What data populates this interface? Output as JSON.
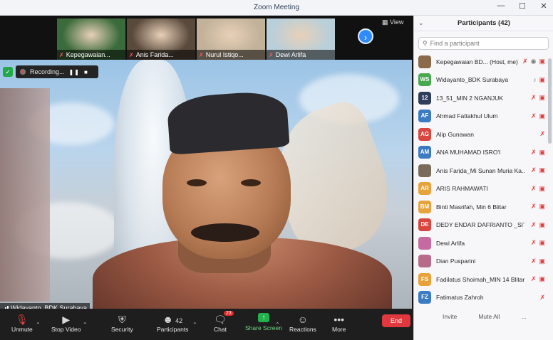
{
  "window": {
    "title": "Zoom Meeting"
  },
  "thumbnails": [
    {
      "name": "Kepegawaian...",
      "bg": "#3a6b3a",
      "muted": true
    },
    {
      "name": "Anis Farida...",
      "bg": "#5a4a3c",
      "muted": true
    },
    {
      "name": "Nurul Istiqo...",
      "bg": "#c3b29a",
      "muted": true
    },
    {
      "name": "Dewi Arlifa",
      "bg": "#b9cfd9",
      "muted": true
    }
  ],
  "view_label": "View",
  "recording": {
    "label": "Recording..."
  },
  "active_speaker": "Widayanto_BDK Surabaya",
  "toolbar": {
    "unmute": "Unmute",
    "stop_video": "Stop Video",
    "security": "Security",
    "participants": "Participants",
    "participants_count": "42",
    "chat": "Chat",
    "chat_badge": "23",
    "share_screen": "Share Screen",
    "reactions": "Reactions",
    "more": "More",
    "end": "End"
  },
  "panel": {
    "title": "Participants (42)",
    "search_placeholder": "Find a participant",
    "invite": "Invite",
    "mute_all": "Mute All",
    "more": "..."
  },
  "participants": [
    {
      "initials": "",
      "name": "Kepegawaian BD... (Host, me)",
      "color": "#8a6a4a",
      "icons": [
        "mic-muted",
        "record",
        "video-off"
      ]
    },
    {
      "initials": "WS",
      "name": "Widayanto_BDK Surabaya",
      "color": "#4aa84f",
      "icons": [
        "mic-on",
        "video-off"
      ]
    },
    {
      "initials": "12",
      "name": "13_51_MIN 2 NGANJUK",
      "color": "#2e3d5a",
      "icons": [
        "mic-muted",
        "video-off"
      ]
    },
    {
      "initials": "AF",
      "name": "Ahmad Fattakhul Ulum",
      "color": "#3b7bc4",
      "icons": [
        "mic-muted",
        "video-off"
      ]
    },
    {
      "initials": "AG",
      "name": "Alip Gunawan",
      "color": "#d9463f",
      "icons": [
        "mic-muted"
      ]
    },
    {
      "initials": "AM",
      "name": "ANA MUHAMAD ISRO'I",
      "color": "#3b7bc4",
      "icons": [
        "mic-muted",
        "video-off"
      ]
    },
    {
      "initials": "",
      "name": "Anis Farida_Mi Sunan Muria Ka...",
      "color": "#7a6a5a",
      "icons": [
        "mic-muted",
        "video-off"
      ]
    },
    {
      "initials": "AR",
      "name": "ARIS RAHMAWATI",
      "color": "#e8a23a",
      "icons": [
        "mic-muted",
        "video-off"
      ]
    },
    {
      "initials": "BM",
      "name": "Binti Masrifah, Min 6 Blitar",
      "color": "#e8a23a",
      "icons": [
        "mic-muted",
        "video-off"
      ]
    },
    {
      "initials": "DE",
      "name": "DEDY ENDAR DAFRIANTO _SITU...",
      "color": "#d9463f",
      "icons": [
        "mic-muted",
        "video-off"
      ]
    },
    {
      "initials": "",
      "name": "Dewi Arlifa",
      "color": "#c66aa0",
      "icons": [
        "mic-muted",
        "video-off"
      ]
    },
    {
      "initials": "",
      "name": "Dian Pusparini",
      "color": "#b86a8a",
      "icons": [
        "mic-muted",
        "video-off"
      ]
    },
    {
      "initials": "FS",
      "name": "Fadilatus Shoimah_MIN 14 Blitar",
      "color": "#e8a23a",
      "icons": [
        "mic-muted",
        "video-off"
      ]
    },
    {
      "initials": "FZ",
      "name": "Fatimatus Zahroh",
      "color": "#3b7bc4",
      "icons": [
        "mic-muted"
      ]
    }
  ]
}
